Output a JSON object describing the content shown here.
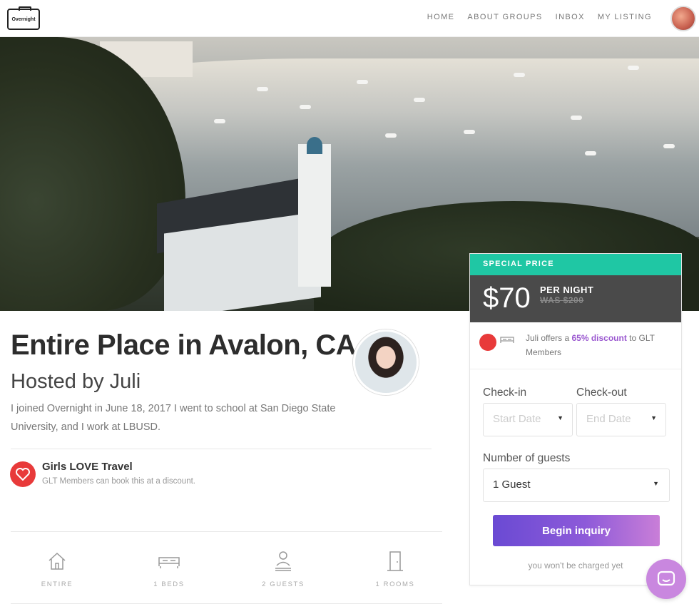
{
  "header": {
    "logo_text": "Overnight",
    "nav": [
      "HOME",
      "ABOUT GROUPS",
      "INBOX",
      "MY LISTING"
    ]
  },
  "listing": {
    "title": "Entire Place in Avalon, CA",
    "hosted_by": "Hosted by Juli",
    "bio": "I joined Overnight in June 18, 2017 I went to school at San Diego State University, and I work at LBUSD."
  },
  "group": {
    "name": "Girls LOVE Travel",
    "description": "GLT Members can book this at a discount."
  },
  "amenities": [
    {
      "icon": "house-icon",
      "label": "ENTIRE"
    },
    {
      "icon": "bed-icon",
      "label": "1 BEDS"
    },
    {
      "icon": "guest-icon",
      "label": "2 GUESTS"
    },
    {
      "icon": "door-icon",
      "label": "1 ROOMS"
    }
  ],
  "booking": {
    "badge": "SPECIAL PRICE",
    "price": "$70",
    "per_night": "PER NIGHT",
    "was": "WAS $200",
    "offer_prefix": "Juli offers a ",
    "offer_pct": "65% discount",
    "offer_suffix": " to GLT Members",
    "checkin_label": "Check-in",
    "checkout_label": "Check-out",
    "checkin_placeholder": "Start Date",
    "checkout_placeholder": "End Date",
    "guests_label": "Number of guests",
    "guests_value": "1 Guest",
    "button": "Begin inquiry",
    "note": "you won't be charged yet"
  },
  "colors": {
    "special_badge": "#1fc7a4",
    "price_bar": "#4a4a4a",
    "discount": "#9b59d0",
    "button_start": "#6a4ad3",
    "button_end": "#c97ed8",
    "glt_red": "#e83a3a",
    "chat": "#c987df"
  }
}
